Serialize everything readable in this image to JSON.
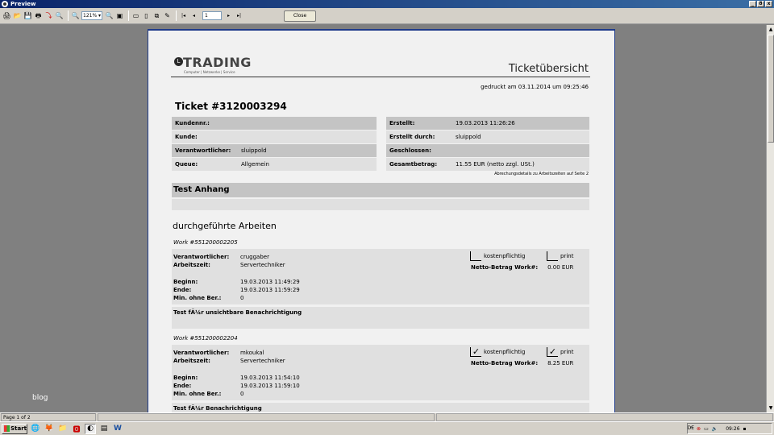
{
  "window": {
    "title": "Preview",
    "controls": [
      "_",
      "8",
      "x"
    ]
  },
  "toolbar": {
    "zoom": "121%",
    "page": "1",
    "close_label": "Close",
    "icons": {
      "print": "🖨",
      "open": "📂",
      "save": "💾",
      "export": "🖶",
      "pdf": "⤵",
      "find": "🔍",
      "zoom_in": "🔍",
      "zoom_out": "🔍",
      "fit_page": "▣",
      "single": "▭",
      "double": "▯",
      "multi": "⧉",
      "edit": "✎",
      "first": "|◂",
      "prev": "◂",
      "next": "▸",
      "last": "▸|"
    }
  },
  "viewer": {
    "blog_label": "blog",
    "scroll_up": "▲",
    "scroll_down": "▼"
  },
  "document": {
    "logo_letter": "L",
    "logo_word": "TRADING",
    "logo_tagline": "Computer | Netzwerke | Service",
    "title": "Ticketübersicht",
    "printed": "gedruckt am 03.11.2014 um 09:25:46",
    "ticket_number": "Ticket #3120003294",
    "left_fields": [
      {
        "label": "Kundennr.:",
        "value": ""
      },
      {
        "label": "Kunde:",
        "value": ""
      },
      {
        "label": "Verantwortlicher:",
        "value": "sluippold"
      },
      {
        "label": "Queue:",
        "value": "Allgemein"
      }
    ],
    "right_fields": [
      {
        "label": "Erstellt:",
        "value": "19.03.2013 11:26:26"
      },
      {
        "label": "Erstellt durch:",
        "value": "sluippold"
      },
      {
        "label": "Geschlossen:",
        "value": ""
      },
      {
        "label": "Gesamtbetrag:",
        "value": "11.55 EUR (netto zzgl. USt.)"
      }
    ],
    "billing_note": "Abrechungsdetails zu Arbeitszeiten auf Seite 2",
    "attachment_title": "Test Anhang",
    "section_title": "durchgeführte Arbeiten",
    "works": [
      {
        "number": "Work #551200002205",
        "labels": {
          "resp": "Verantwortlicher:",
          "time": "Arbeitszeit:",
          "begin": "Beginn:",
          "end": "Ende:",
          "min": "Min. ohne Ber.:"
        },
        "responsible": "cruggaber",
        "worktime": "Servertechniker",
        "begin": "19.03.2013 11:49:29",
        "end": "19.03.2013 11:59:29",
        "minutes": "0",
        "chargeable_label": "kostenpflichtig",
        "chargeable_mark": "",
        "print_label": "print",
        "print_mark": "",
        "netto_label": "Netto-Betrag Work#:",
        "netto_value": "0.00 EUR",
        "title": "Test fÃ¼r unsichtbare Benachrichtigung"
      },
      {
        "number": "Work #551200002204",
        "labels": {
          "resp": "Verantwortlicher:",
          "time": "Arbeitszeit:",
          "begin": "Beginn:",
          "end": "Ende:",
          "min": "Min. ohne Ber.:"
        },
        "responsible": "mkoukal",
        "worktime": "Servertechniker",
        "begin": "19.03.2013 11:54:10",
        "end": "19.03.2013 11:59:10",
        "minutes": "0",
        "chargeable_label": "kostenpflichtig",
        "chargeable_mark": "✓",
        "print_label": "print",
        "print_mark": "✓",
        "netto_label": "Netto-Betrag Work#:",
        "netto_value": "8.25 EUR",
        "title": "Test fÃ¼r Benachrichtigung"
      }
    ]
  },
  "status": {
    "page_info": "Page 1 of 2"
  },
  "taskbar": {
    "start_label": "Start",
    "language": "DE",
    "clock": "09:26",
    "quick_icons": [
      "🌐",
      "🦊",
      "📁",
      "🅾",
      "◐",
      "▤",
      "W"
    ]
  }
}
